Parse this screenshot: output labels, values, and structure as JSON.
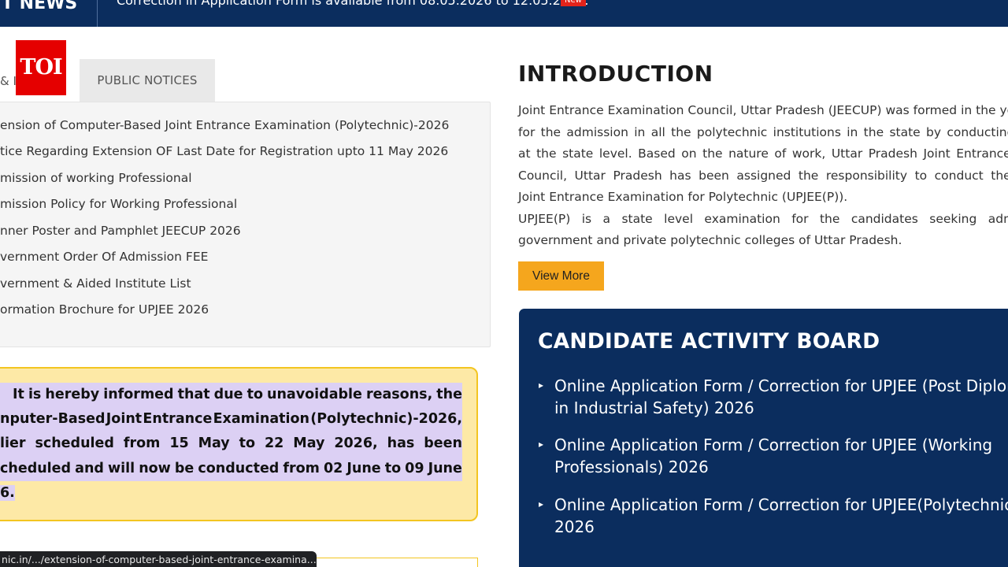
{
  "ticker": {
    "label": "T NEWS",
    "text": "Correction in Application Form is available from 08.05.2026 to 12.05.2026.",
    "badge": "New"
  },
  "tabs": {
    "active_label": "& I",
    "public_notices": "PUBLIC NOTICES"
  },
  "logo": {
    "text": "TOI"
  },
  "notices": [
    "ension of Computer-Based Joint Entrance Examination (Polytechnic)-2026",
    "tice Regarding Extension OF Last Date for Registration upto 11 May 2026",
    "mission of working Professional",
    "mission Policy for Working Professional",
    "nner Poster and Pamphlet JEECUP 2026",
    "vernment Order Of Admission FEE",
    "vernment & Aided Institute List",
    "ormation Brochure for UPJEE 2026"
  ],
  "alert": {
    "line1": [
      "It",
      "is",
      "hereby",
      "informed",
      "that",
      "due",
      "to",
      "unavoidable",
      "reasons,",
      "the"
    ],
    "line2": [
      "nputer-Based",
      "Joint",
      "Entrance",
      "Examination",
      "(Polytechnic)-2026,"
    ],
    "line3": [
      "lier",
      "scheduled",
      "from",
      "15",
      "May",
      "to",
      "22",
      "May",
      "2026,",
      "has",
      "been"
    ],
    "line4": [
      "cheduled",
      "and",
      "will",
      "now",
      "be",
      "conducted",
      "from",
      "02",
      "June",
      "to",
      "09",
      "June"
    ],
    "line5": "6."
  },
  "status_url": "nic.in/.../extension-of-computer-based-joint-entrance-examina...",
  "intro": {
    "title": "INTRODUCTION",
    "lines": [
      "Joint Entrance Examination Council, Uttar Pradesh (JEECUP) was formed in the yea",
      "for the admission in all the polytechnic institutions in the state by conducting admi",
      "at the state level. Based on the nature of work, Uttar Pradesh Joint Entrance Exa",
      "Council, Uttar Pradesh has been assigned the responsibility to conduct the Utta",
      "Joint Entrance Examination for Polytechnic (UPJEE(P)).",
      "UPJEE(P) is a state level examination for the candidates seeking admissio",
      "government and private polytechnic colleges of Uttar Pradesh."
    ],
    "view_more": "View More"
  },
  "board": {
    "title": "CANDIDATE ACTIVITY BOARD",
    "items": [
      {
        "line1": "Online Application Form / Correction for UPJEE (Post Diplom",
        "line2": "in Industrial Safety) 2026"
      },
      {
        "line1": "Online Application Form / Correction for UPJEE (Working",
        "line2": "Professionals) 2026"
      },
      {
        "line1": "Online Application Form / Correction for UPJEE(Polytechnic)",
        "line2": "2026"
      }
    ]
  },
  "colors": {
    "navy": "#0b2d5e",
    "accent_orange": "#f5a61d",
    "alert_bg": "#fde9a6",
    "alert_border": "#f3c520",
    "highlight": "#dcd0f4",
    "badge_red": "#e3231b",
    "logo_red": "#e50000"
  }
}
